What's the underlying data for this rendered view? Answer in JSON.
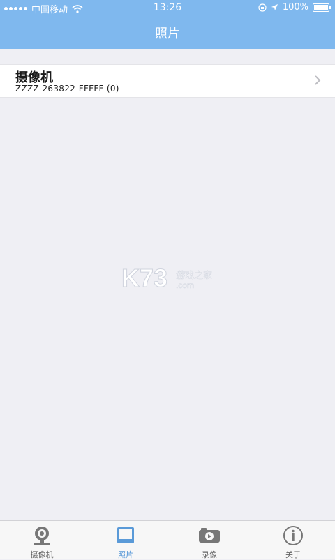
{
  "status_bar": {
    "carrier": "中国移动",
    "time": "13:26",
    "battery": "100%"
  },
  "nav": {
    "title": "照片"
  },
  "list": [
    {
      "title": "摄像机",
      "subtitle": "ZZZZ-263822-FFFFF (0)"
    }
  ],
  "watermark": {
    "logo": "K73",
    "cn": "游戏之家",
    "domain": ".com"
  },
  "tabs": [
    {
      "label": "摄像机",
      "icon": "webcam-icon",
      "active": false
    },
    {
      "label": "照片",
      "icon": "photo-icon",
      "active": true
    },
    {
      "label": "录像",
      "icon": "video-icon",
      "active": false
    },
    {
      "label": "关于",
      "icon": "info-icon",
      "active": false
    }
  ],
  "colors": {
    "header": "#7fb8ee",
    "background": "#efeff4",
    "active_tab": "#5a9ad8"
  }
}
